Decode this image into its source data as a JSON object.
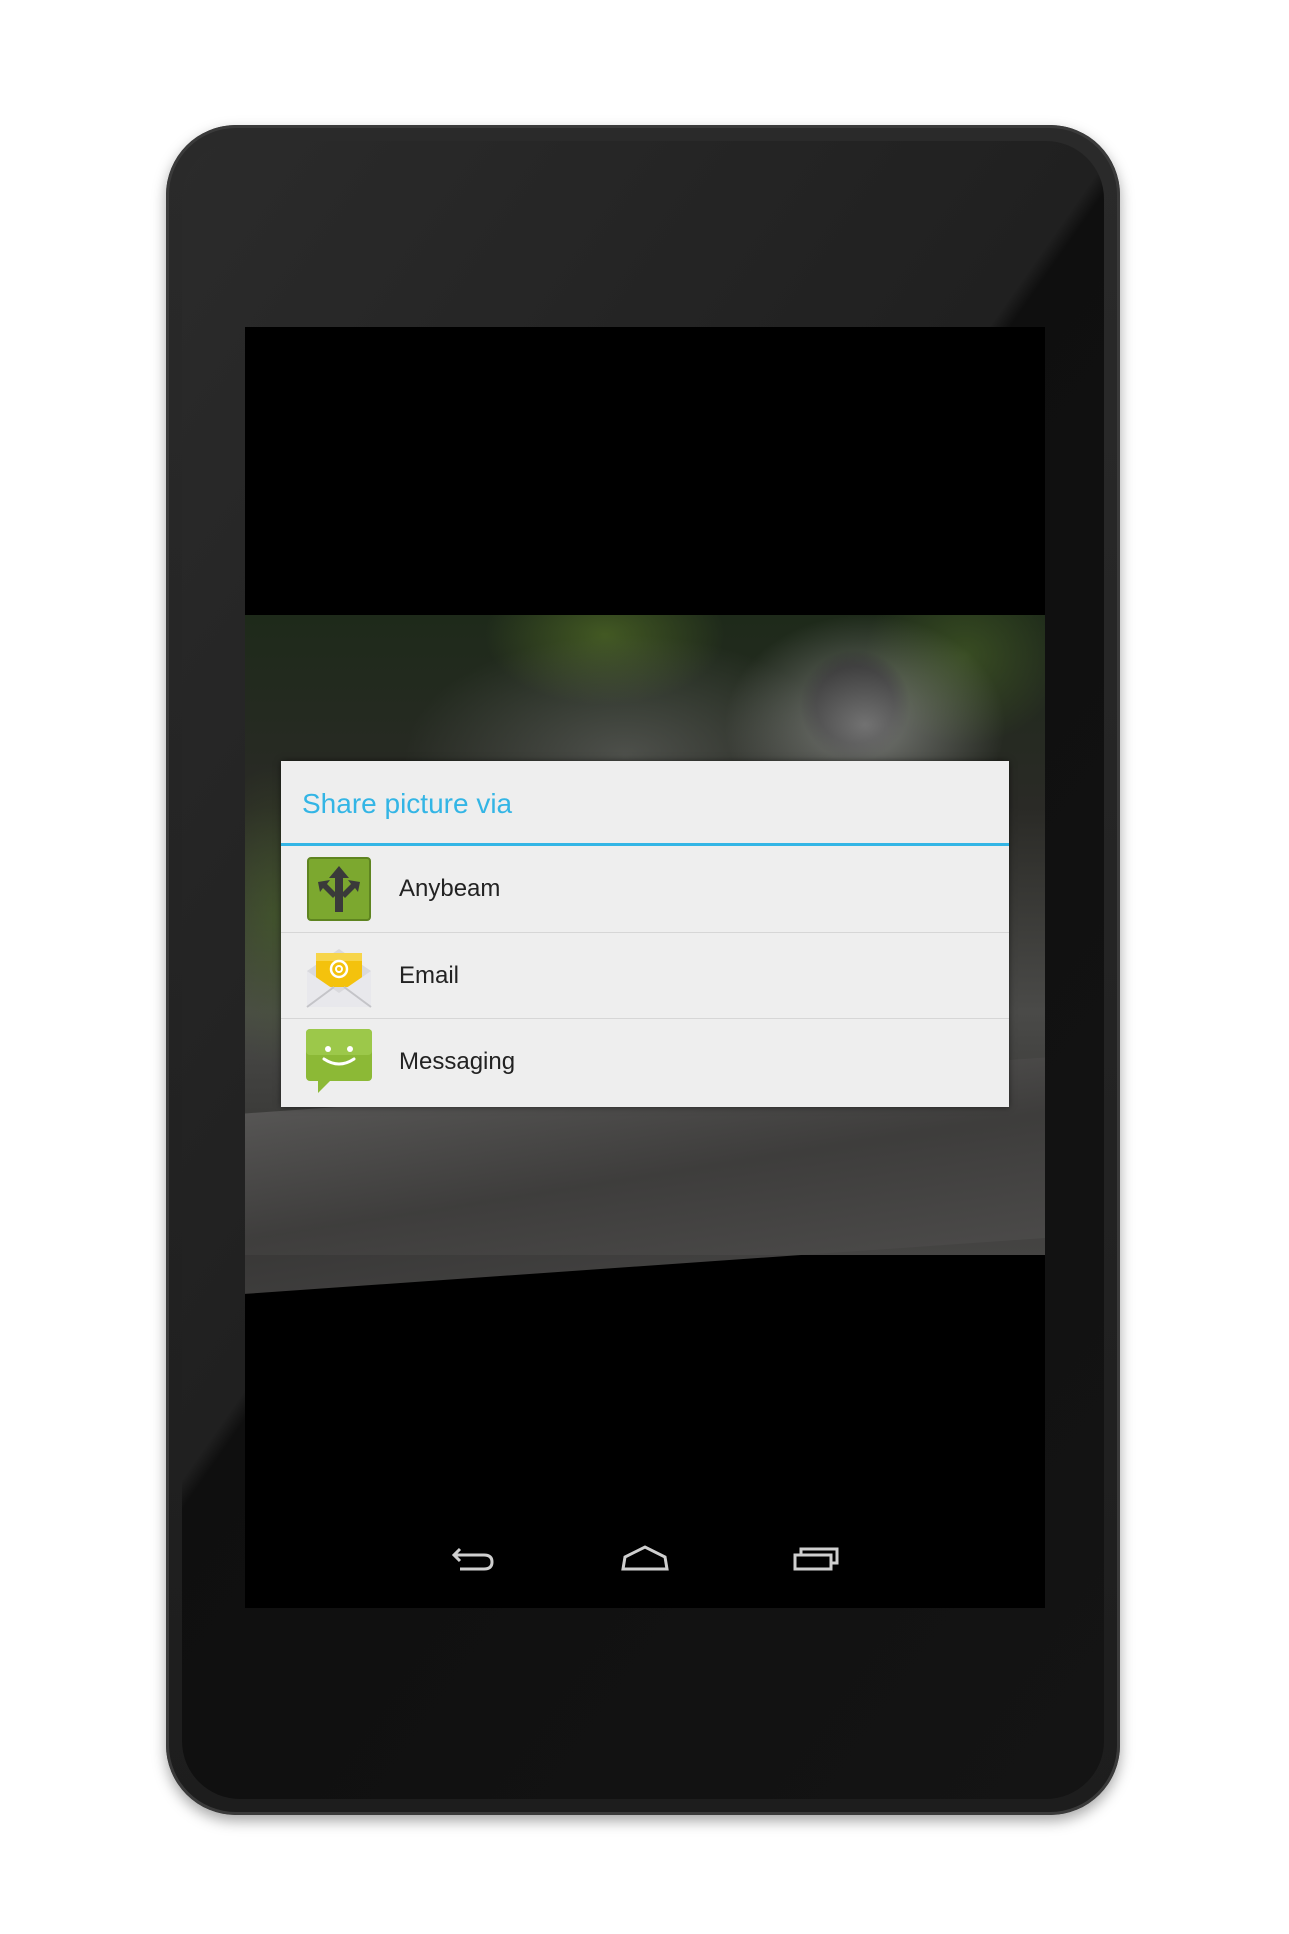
{
  "dialog": {
    "title": "Share picture via",
    "items": [
      {
        "label": "Anybeam",
        "icon": "anybeam-icon"
      },
      {
        "label": "Email",
        "icon": "email-icon"
      },
      {
        "label": "Messaging",
        "icon": "messaging-icon"
      }
    ]
  },
  "navbar": {
    "buttons": [
      "back-icon",
      "home-icon",
      "recents-icon"
    ]
  },
  "colors": {
    "accent": "#33b5e5",
    "dialog_bg": "#eeeeee",
    "app_green": "#7ca82f"
  }
}
